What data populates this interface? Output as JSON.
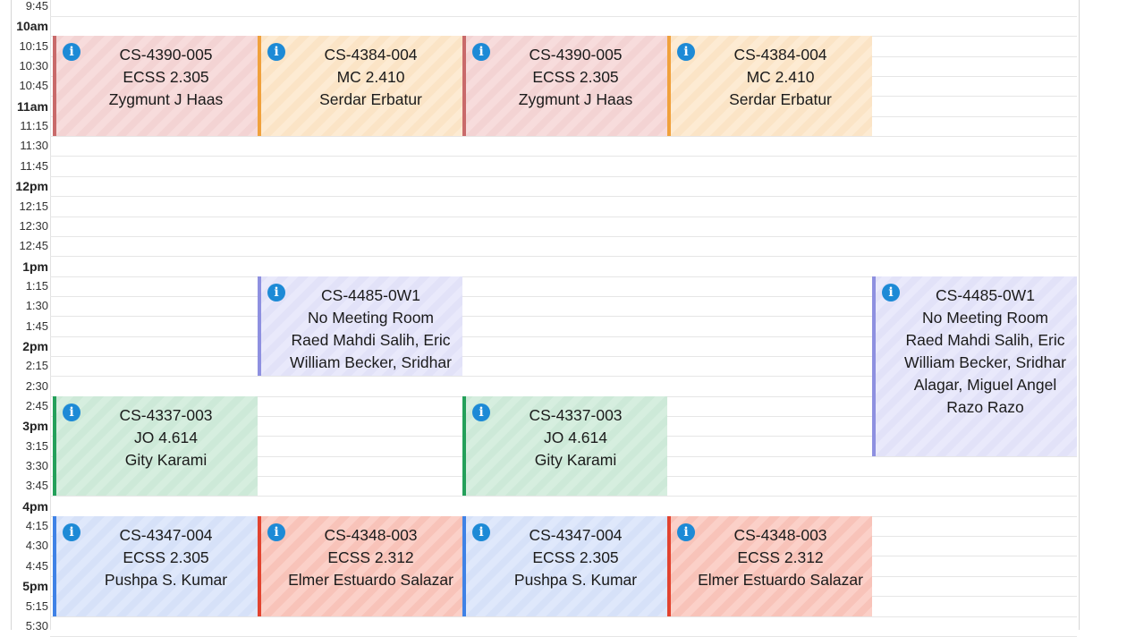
{
  "time_slots": [
    {
      "label": "9:45",
      "hour": false
    },
    {
      "label": "10am",
      "hour": true
    },
    {
      "label": "10:15",
      "hour": false
    },
    {
      "label": "10:30",
      "hour": false
    },
    {
      "label": "10:45",
      "hour": false
    },
    {
      "label": "11am",
      "hour": true
    },
    {
      "label": "11:15",
      "hour": false
    },
    {
      "label": "11:30",
      "hour": false
    },
    {
      "label": "11:45",
      "hour": false
    },
    {
      "label": "12pm",
      "hour": true
    },
    {
      "label": "12:15",
      "hour": false
    },
    {
      "label": "12:30",
      "hour": false
    },
    {
      "label": "12:45",
      "hour": false
    },
    {
      "label": "1pm",
      "hour": true
    },
    {
      "label": "1:15",
      "hour": false
    },
    {
      "label": "1:30",
      "hour": false
    },
    {
      "label": "1:45",
      "hour": false
    },
    {
      "label": "2pm",
      "hour": true
    },
    {
      "label": "2:15",
      "hour": false
    },
    {
      "label": "2:30",
      "hour": false
    },
    {
      "label": "2:45",
      "hour": false
    },
    {
      "label": "3pm",
      "hour": true
    },
    {
      "label": "3:15",
      "hour": false
    },
    {
      "label": "3:30",
      "hour": false
    },
    {
      "label": "3:45",
      "hour": false
    },
    {
      "label": "4pm",
      "hour": true
    },
    {
      "label": "4:15",
      "hour": false
    },
    {
      "label": "4:30",
      "hour": false
    },
    {
      "label": "4:45",
      "hour": false
    },
    {
      "label": "5pm",
      "hour": true
    },
    {
      "label": "5:15",
      "hour": false
    },
    {
      "label": "5:30",
      "hour": false
    }
  ],
  "info_icon": {
    "name": "info-icon",
    "glyph": "i",
    "color": "#1d8ad6"
  },
  "colors": {
    "pink": "#c96a6a",
    "orange": "#f0a13c",
    "purple": "#8e90e0",
    "green": "#24a05a",
    "blue": "#3f82e6",
    "red": "#e2432f"
  },
  "events": [
    {
      "day": 0,
      "start": "10am",
      "end": "11:15",
      "color": "pink",
      "lines": [
        "CS-4390-005",
        "ECSS 2.305",
        "Zygmunt J Haas"
      ]
    },
    {
      "day": 1,
      "start": "10am",
      "end": "11:15",
      "color": "orange",
      "lines": [
        "CS-4384-004",
        "MC 2.410",
        "Serdar Erbatur"
      ]
    },
    {
      "day": 2,
      "start": "10am",
      "end": "11:15",
      "color": "pink",
      "lines": [
        "CS-4390-005",
        "ECSS 2.305",
        "Zygmunt J Haas"
      ]
    },
    {
      "day": 3,
      "start": "10am",
      "end": "11:15",
      "color": "orange",
      "lines": [
        "CS-4384-004",
        "MC 2.410",
        "Serdar Erbatur"
      ]
    },
    {
      "day": 1,
      "start": "1pm",
      "end": "2:15",
      "color": "purple",
      "lines": [
        "CS-4485-0W1",
        "No Meeting Room",
        "Raed Mahdi Salih, Eric William Becker, Sridhar Alagar, Miguel Angel Razo Razo"
      ]
    },
    {
      "day": 4,
      "start": "1pm",
      "end": "3:15",
      "color": "purple",
      "lines": [
        "CS-4485-0W1",
        "No Meeting Room",
        "Raed Mahdi Salih, Eric William Becker, Sridhar Alagar, Miguel Angel Razo Razo"
      ]
    },
    {
      "day": 0,
      "start": "2:30",
      "end": "3:45",
      "color": "green",
      "lines": [
        "CS-4337-003",
        "JO 4.614",
        "Gity Karami"
      ]
    },
    {
      "day": 2,
      "start": "2:30",
      "end": "3:45",
      "color": "green",
      "lines": [
        "CS-4337-003",
        "JO 4.614",
        "Gity Karami"
      ]
    },
    {
      "day": 0,
      "start": "4pm",
      "end": "5:15",
      "color": "blue",
      "lines": [
        "CS-4347-004",
        "ECSS 2.305",
        "Pushpa S. Kumar"
      ]
    },
    {
      "day": 1,
      "start": "4pm",
      "end": "5:15",
      "color": "red",
      "lines": [
        "CS-4348-003",
        "ECSS 2.312",
        "Elmer Estuardo Salazar"
      ]
    },
    {
      "day": 2,
      "start": "4pm",
      "end": "5:15",
      "color": "blue",
      "lines": [
        "CS-4347-004",
        "ECSS 2.305",
        "Pushpa S. Kumar"
      ]
    },
    {
      "day": 3,
      "start": "4pm",
      "end": "5:15",
      "color": "red",
      "lines": [
        "CS-4348-003",
        "ECSS 2.312",
        "Elmer Estuardo Salazar"
      ]
    }
  ]
}
